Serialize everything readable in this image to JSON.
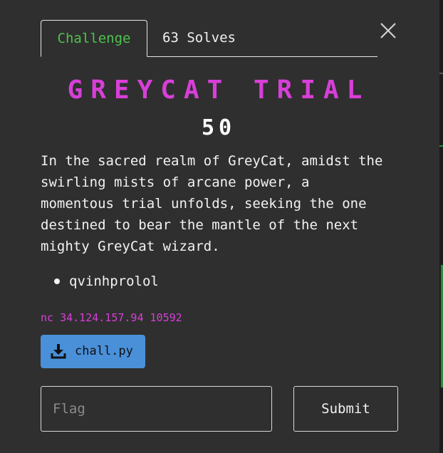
{
  "tabs": {
    "challenge_label": "Challenge",
    "solves_label": "63 Solves"
  },
  "challenge": {
    "name": "GREYCAT TRIAL",
    "points": "50",
    "description": "In the sacred realm of GreyCat, amidst the swirling mists of arcane power, a momentous trial unfolds, seeking the one destined to bear the mantle of the next mighty GreyCat wizard.",
    "hints": [
      "qvinhprolol"
    ],
    "connection": "nc 34.124.157.94 10592",
    "file": {
      "label": "chall.py",
      "icon": "download-icon"
    }
  },
  "form": {
    "flag_placeholder": "Flag",
    "flag_value": "",
    "submit_label": "Submit"
  },
  "colors": {
    "background": "#2f2f2f",
    "challenge_tab": "#4ec24e",
    "title": "#d83fd8",
    "connection": "#d83fd8",
    "file_button": "#4a90d9",
    "edge_accent": "#2e8b3e"
  },
  "icons": {
    "close": "close-icon",
    "download": "download-icon"
  }
}
